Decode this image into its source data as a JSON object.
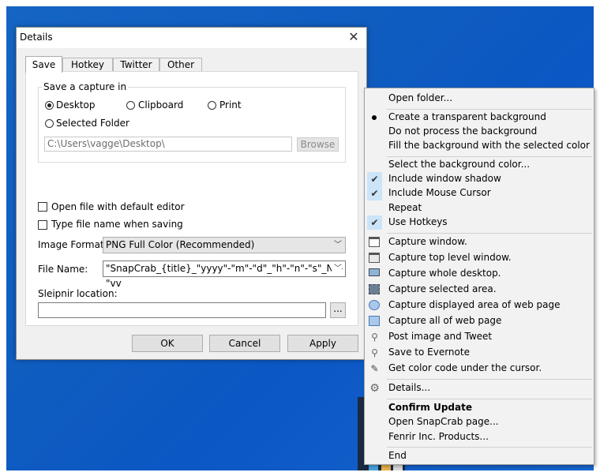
{
  "dialog": {
    "title": "Details",
    "tabs": [
      "Save",
      "Hotkey",
      "Twitter",
      "Other"
    ],
    "save_group": {
      "label": "Save a capture in",
      "options": [
        "Desktop",
        "Clipboard",
        "Print",
        "Selected Folder"
      ],
      "selected": "Desktop",
      "path": "C:\\Users\\vagge\\Desktop\\",
      "browse_label": "Browse"
    },
    "open_with_editor_label": "Open file with default editor",
    "type_name_label": "Type file name when saving",
    "image_format_label": "Image Format:",
    "image_format_value": "PNG Full Color (Recommended)",
    "file_name_label": "File Name:",
    "file_name_value": "\"SnapCrab_{title}_\"yyyy\"-\"m\"-\"d\"_\"h\"-\"n\"-\"s\"_No-\"vv",
    "sleipnir_label": "Sleipnir location:",
    "sleipnir_value": "",
    "dots_label": "...",
    "buttons": {
      "ok": "OK",
      "cancel": "Cancel",
      "apply": "Apply"
    }
  },
  "menu": {
    "items": [
      "Open folder...",
      "Create a transparent background",
      "Do not process the background",
      "Fill the background with the selected color",
      "Select the background color...",
      "Include window shadow",
      "Include Mouse Cursor",
      "Repeat",
      "Use Hotkeys",
      "Capture window.",
      "Capture top level window.",
      "Capture whole desktop.",
      "Capture selected area.",
      "Capture displayed area of web page",
      "Capture all of web page",
      "Post image and Tweet",
      "Save to Evernote",
      "Get color code under the cursor.",
      "Details...",
      "Confirm Update",
      "Open SnapCrab page...",
      "Fenrir Inc. Products...",
      "End"
    ],
    "checked": [
      "Include window shadow",
      "Include Mouse Cursor",
      "Use Hotkeys"
    ],
    "radio_selected": "Create a transparent background",
    "highlight_color": "#cce4f7"
  }
}
